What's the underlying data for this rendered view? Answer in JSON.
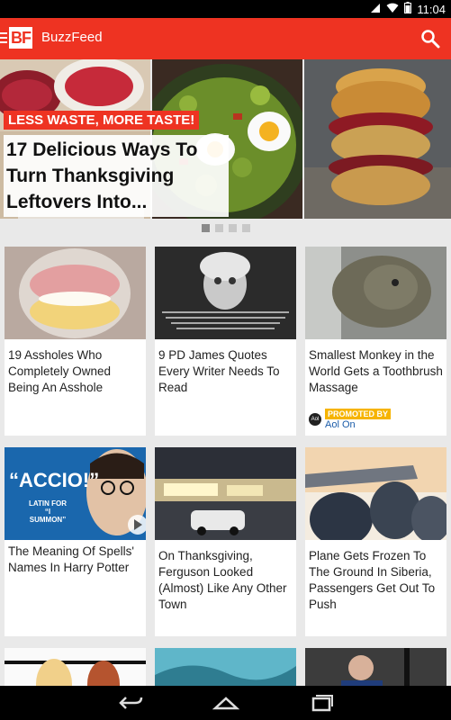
{
  "status_bar": {
    "time": "11:04",
    "icons": [
      "wifi-icon",
      "signal-icon",
      "battery-icon"
    ]
  },
  "app_bar": {
    "logo_text": "BF",
    "title": "BuzzFeed",
    "icons": [
      "menu-icon",
      "search-icon"
    ]
  },
  "hero": {
    "tag": "LESS WASTE, MORE TASTE!",
    "headline": "17 Delicious  Ways To Turn Thanksgiving Leftovers Into...",
    "pagination": {
      "total": 4,
      "active": 1
    }
  },
  "cards": [
    {
      "caption": "19 Assholes Who Completely Owned Being An Asshole"
    },
    {
      "caption": "9 PD James Quotes Every Writer Needs To Read"
    },
    {
      "caption": "Smallest Monkey in the World Gets a Toothbrush Massage",
      "promo_label": "PROMOTED BY",
      "promo_brand": "Aol On",
      "promo_logo": "Aol"
    },
    {
      "caption": "The Meaning Of Spells' Names In Harry Potter",
      "thumb_text": "“ACCIO!”",
      "thumb_subtext": "LATIN FOR “I SUMMON”"
    },
    {
      "caption": "On Thanksgiving, Ferguson Looked (Almost) Like Any Other Town"
    },
    {
      "caption": "Plane Gets Frozen To The Ground In Siberia, Passengers Get Out To Push"
    }
  ],
  "colors": {
    "brand": "#ee3322",
    "promo": "#f6b400",
    "promo_brand": "#1a5ba8"
  }
}
